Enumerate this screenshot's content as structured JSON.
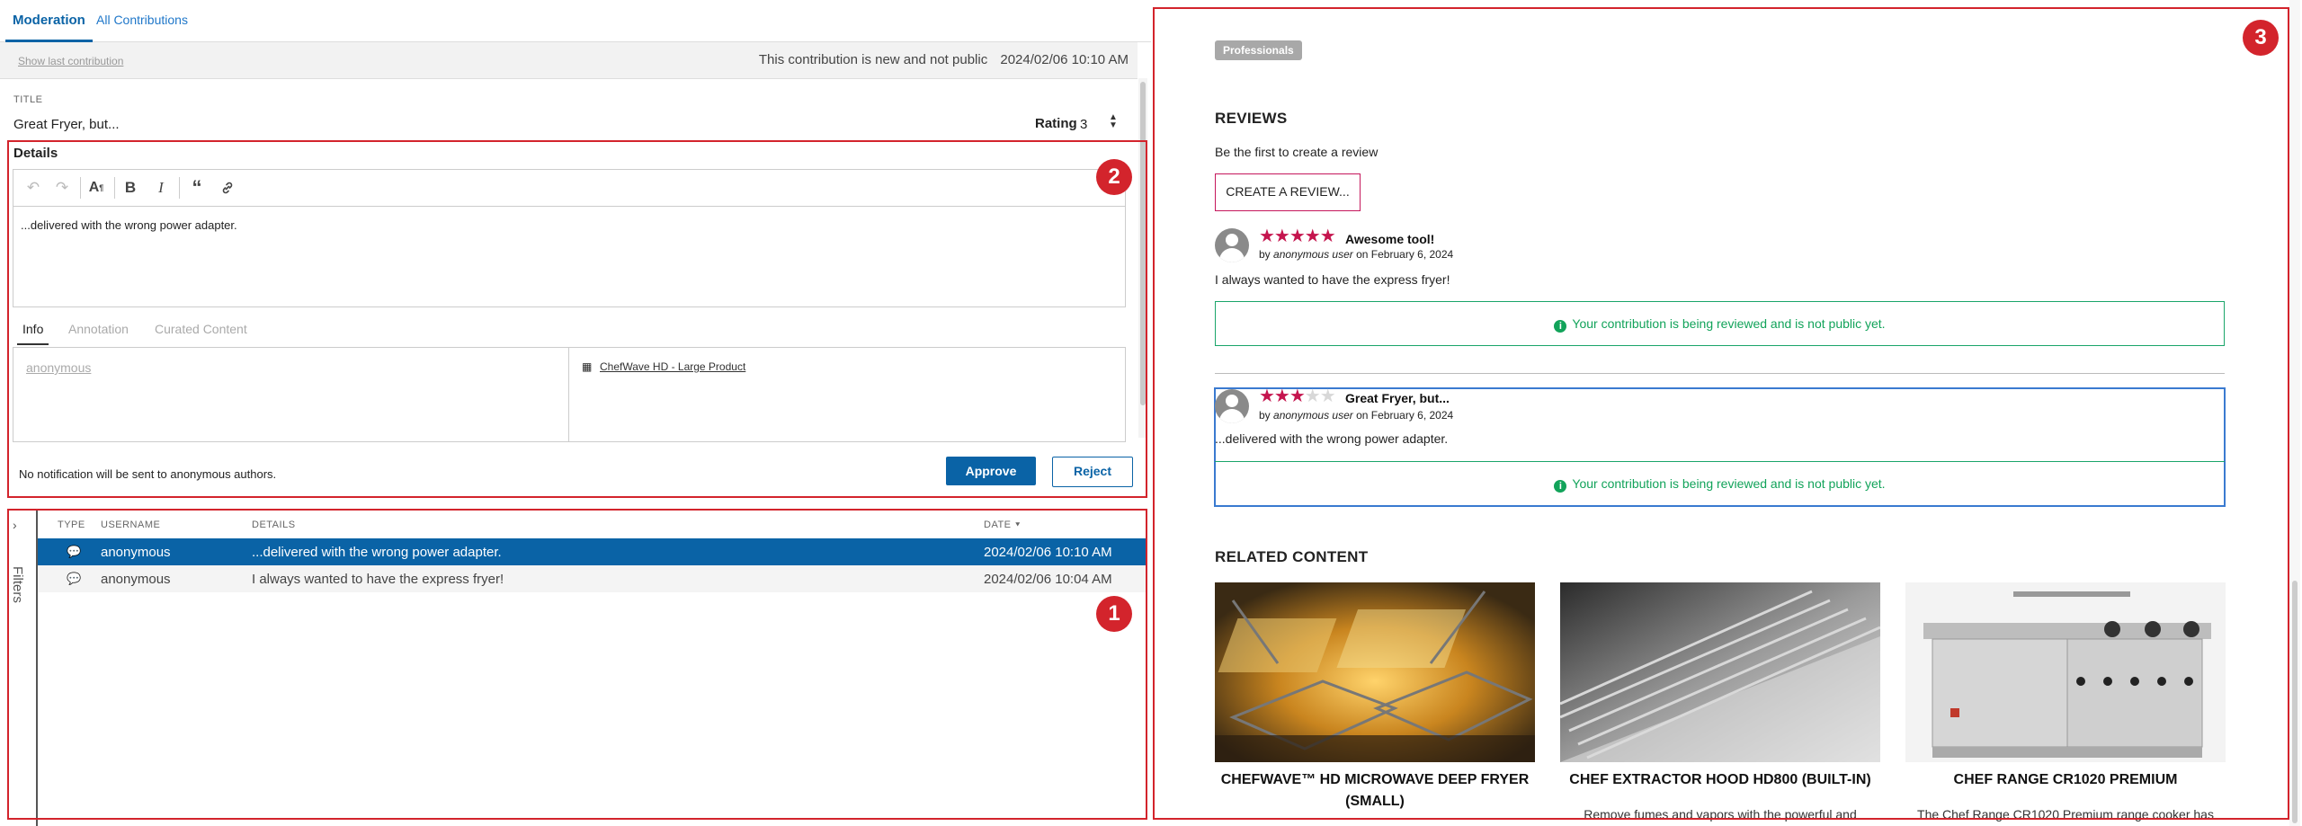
{
  "tabs": [
    {
      "label": "Moderation"
    },
    {
      "label": "All Contributions"
    }
  ],
  "status": {
    "show_last": "Show last contribution",
    "message": "This contribution is new and not public",
    "date": "2024/02/06 10:10 AM"
  },
  "form": {
    "title_label": "TITLE",
    "title_value": "Great Fryer, but...",
    "rating_label": "Rating",
    "rating_value": "3",
    "details_label": "Details",
    "details_text": "...delivered with the wrong power adapter."
  },
  "subtabs": [
    {
      "label": "Info"
    },
    {
      "label": "Annotation"
    },
    {
      "label": "Curated Content"
    }
  ],
  "info": {
    "author": "anonymous",
    "product": "ChefWave HD - Large Product"
  },
  "notification": "No notification will be sent to anonymous authors.",
  "actions": {
    "approve": "Approve",
    "reject": "Reject"
  },
  "filters_label": "Filters",
  "table": {
    "headers": [
      "TYPE",
      "USERNAME",
      "DETAILS",
      "DATE"
    ],
    "rows": [
      {
        "username": "anonymous",
        "details": "...delivered with the wrong power adapter.",
        "date": "2024/02/06 10:10 AM"
      },
      {
        "username": "anonymous",
        "details": "I always wanted to have the express fryer!",
        "date": "2024/02/06 10:04 AM"
      }
    ]
  },
  "badges": [
    "1",
    "2",
    "3"
  ],
  "preview": {
    "tag": "Professionals",
    "reviews_heading": "REVIEWS",
    "first_review_prompt": "Be the first to create a review",
    "create_button": "CREATE A REVIEW...",
    "by_prefix": "by",
    "on_word": "on",
    "reviews": [
      {
        "title": "Awesome tool!",
        "rating": 5,
        "author": "anonymous user",
        "date": "February 6, 2024",
        "text": "I always wanted to have the express fryer!",
        "notice": "Your contribution is being reviewed and is not public yet."
      },
      {
        "title": "Great Fryer, but...",
        "rating": 3,
        "author": "anonymous user",
        "date": "February 6, 2024",
        "text": "...delivered with the wrong power adapter.",
        "notice": "Your contribution is being reviewed and is not public yet."
      }
    ],
    "related_heading": "RELATED CONTENT",
    "related": [
      {
        "title": "CHEFWAVE™ HD MICROWAVE DEEP FRYER (SMALL)",
        "desc": ""
      },
      {
        "title": "CHEF EXTRACTOR HOOD HD800 (BUILT-IN)",
        "desc": "Remove fumes and vapors with the powerful and"
      },
      {
        "title": "CHEF RANGE CR1020 PREMIUM",
        "desc": "The Chef Range CR1020 Premium range cooker has"
      }
    ]
  },
  "colors": {
    "accent": "#0a63a6",
    "highlight": "#d3242c",
    "star": "#c5154e",
    "success": "#12a35a"
  }
}
